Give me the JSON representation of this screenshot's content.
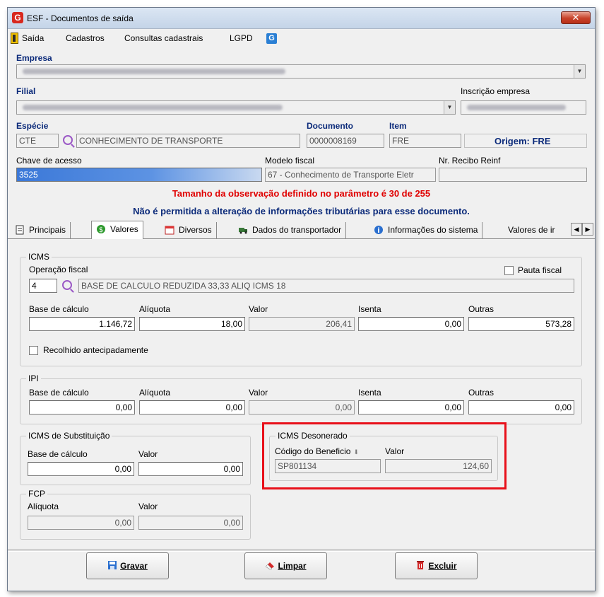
{
  "window": {
    "title": "ESF - Documentos de saída",
    "close_label": "✕"
  },
  "menu": {
    "items": [
      "Saída",
      "Cadastros",
      "Consultas cadastrais",
      "LGPD"
    ]
  },
  "empresa": {
    "label": "Empresa",
    "value": ""
  },
  "filial": {
    "label": "Filial",
    "value": ""
  },
  "inscricao": {
    "label": "Inscrição empresa",
    "value": ""
  },
  "especie": {
    "label": "Espécie",
    "code": "CTE",
    "description": "CONHECIMENTO DE TRANSPORTE"
  },
  "documento": {
    "label": "Documento",
    "value": "0000008169"
  },
  "item": {
    "label": "Item",
    "value": "FRE"
  },
  "origem": "Origem: FRE",
  "chave": {
    "label": "Chave de acesso",
    "value": "3525"
  },
  "modelo": {
    "label": "Modelo fiscal",
    "value": "67 - Conhecimento de Transporte Eletr"
  },
  "recibo": {
    "label": "Nr. Recibo Reinf",
    "value": ""
  },
  "messages": {
    "red": "Tamanho da observação definido no parâmetro é 30 de 255",
    "blue": "Não é permitida a alteração de informações tributárias para esse documento."
  },
  "tabs": [
    {
      "label": "Principais"
    },
    {
      "label": "Valores"
    },
    {
      "label": "Diversos"
    },
    {
      "label": "Dados do transportador"
    },
    {
      "label": "Informações do sistema"
    },
    {
      "label": "Valores de ir"
    }
  ],
  "icms": {
    "title": "ICMS",
    "operacao_label": "Operação fiscal",
    "operacao_code": "4",
    "operacao_desc": "BASE DE CALCULO REDUZIDA  33,33  ALIQ ICMS 18",
    "pauta_label": "Pauta fiscal",
    "base_label": "Base de cálculo",
    "base": "1.146,72",
    "aliq_label": "Alíquota",
    "aliq": "18,00",
    "valor_label": "Valor",
    "valor": "206,41",
    "isenta_label": "Isenta",
    "isenta": "0,00",
    "outras_label": "Outras",
    "outras": "573,28",
    "recolhido_label": "Recolhido antecipadamente"
  },
  "ipi": {
    "title": "IPI",
    "base_label": "Base de cálculo",
    "base": "0,00",
    "aliq_label": "Alíquota",
    "aliq": "0,00",
    "valor_label": "Valor",
    "valor": "0,00",
    "isenta_label": "Isenta",
    "isenta": "0,00",
    "outras_label": "Outras",
    "outras": "0,00"
  },
  "icms_st": {
    "title": "ICMS de Substituição",
    "base_label": "Base de cálculo",
    "base": "0,00",
    "valor_label": "Valor",
    "valor": "0,00"
  },
  "fcp": {
    "title": "FCP",
    "aliq_label": "Alíquota",
    "aliq": "0,00",
    "valor_label": "Valor",
    "valor": "0,00"
  },
  "icms_deson": {
    "title": "ICMS Desonerado",
    "codigo_label": "Código do Beneficio",
    "codigo": "SP801134",
    "valor_label": "Valor",
    "valor": "124,60"
  },
  "buttons": {
    "gravar": "Gravar",
    "limpar": "Limpar",
    "excluir": "Excluir"
  },
  "colors": {
    "accent_red": "#e8101a",
    "label_blue": "#0b2a7a"
  }
}
